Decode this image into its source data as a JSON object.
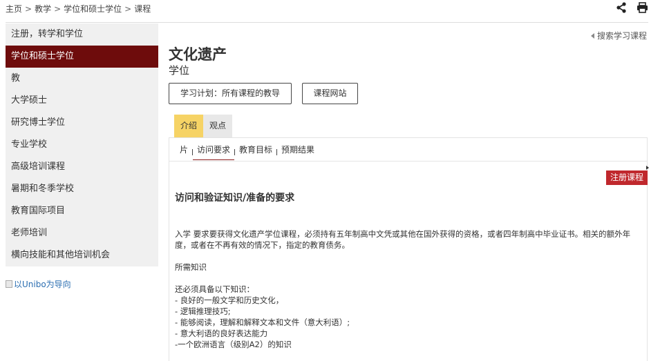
{
  "breadcrumb": [
    "主页",
    "教学",
    "学位和硕士学位",
    "课程"
  ],
  "icons": {
    "share": "share-icon",
    "print": "print-icon"
  },
  "sidebar": {
    "items": [
      {
        "label": "注册，转学和学位"
      },
      {
        "label": "学位和硕士学位",
        "active": true
      },
      {
        "label": "教"
      },
      {
        "label": "大学硕士"
      },
      {
        "label": "研究博士学位"
      },
      {
        "label": "专业学校"
      },
      {
        "label": "高级培训课程"
      },
      {
        "label": "暑期和冬季学校"
      },
      {
        "label": "教育国际项目"
      },
      {
        "label": "老师培训"
      },
      {
        "label": "横向技能和其他培训机会"
      }
    ],
    "unibo_link": "以Unibo为导向"
  },
  "back_link": "搜索学习课程",
  "page": {
    "title": "文化遗产",
    "subtitle": "学位"
  },
  "buttons": {
    "study_plan": "学习计划：所有课程的教导",
    "course_site": "课程网站"
  },
  "tabs": [
    {
      "label": "介绍",
      "active": true
    },
    {
      "label": "观点"
    }
  ],
  "subnav": [
    {
      "label": "片"
    },
    {
      "label": "访问要求",
      "active": true
    },
    {
      "label": "教育目标"
    },
    {
      "label": "预期结果"
    }
  ],
  "register_label": "注册课程",
  "content": {
    "heading": "访问和验证知识/准备的要求",
    "para1": "入学 要求要获得文化遗产学位课程，必须持有五年制高中文凭或其他在国外获得的资格，或者四年制高中毕业证书。相关的额外年度，或者在不再有效的情况下，指定的教育债务。",
    "para2": "所需知识",
    "para3": "还必须具备以下知识：",
    "bullets": [
      "- 良好的一般文学和历史文化，",
      "- 逻辑推理技巧;",
      "- 能够阅读，理解和解释文本和文件（意大利语）;",
      "- 意大利语的良好表达能力",
      "-一个欧洲语言（级别A2）的知识"
    ]
  },
  "colors": {
    "accent": "#6e0c0c",
    "tab_active": "#f6d365",
    "register": "#c0282d"
  }
}
